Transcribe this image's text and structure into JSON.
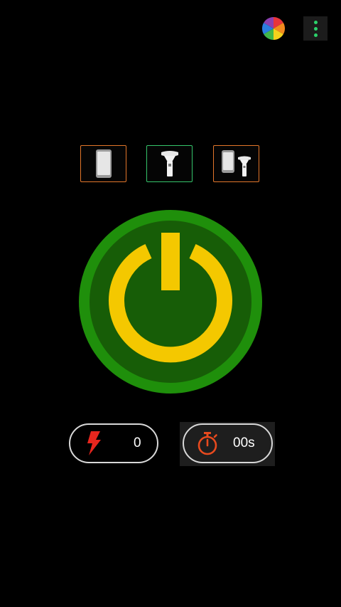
{
  "toolbar": {
    "color_picker_icon": "color-wheel-icon",
    "menu_icon": "overflow-menu-icon"
  },
  "modes": [
    {
      "icon": "phone-screen-icon",
      "selected": false
    },
    {
      "icon": "flashlight-icon",
      "selected": true
    },
    {
      "icon": "phone-and-flashlight-icon",
      "selected": false
    }
  ],
  "power": {
    "icon": "power-icon",
    "state": "on",
    "colors": {
      "outer": "#1f8f0b",
      "inner": "#175d07",
      "symbol": "#f4c800"
    }
  },
  "flash_counter": {
    "icon": "lightning-icon",
    "value": "0"
  },
  "timer": {
    "icon": "stopwatch-icon",
    "value": "00s"
  },
  "accent_colors": {
    "selected_border": "#34c46a",
    "unselected_border": "#e2762a",
    "menu_dots": "#2bd26a",
    "lightning": "#e8261e",
    "stopwatch": "#e84a1e"
  }
}
